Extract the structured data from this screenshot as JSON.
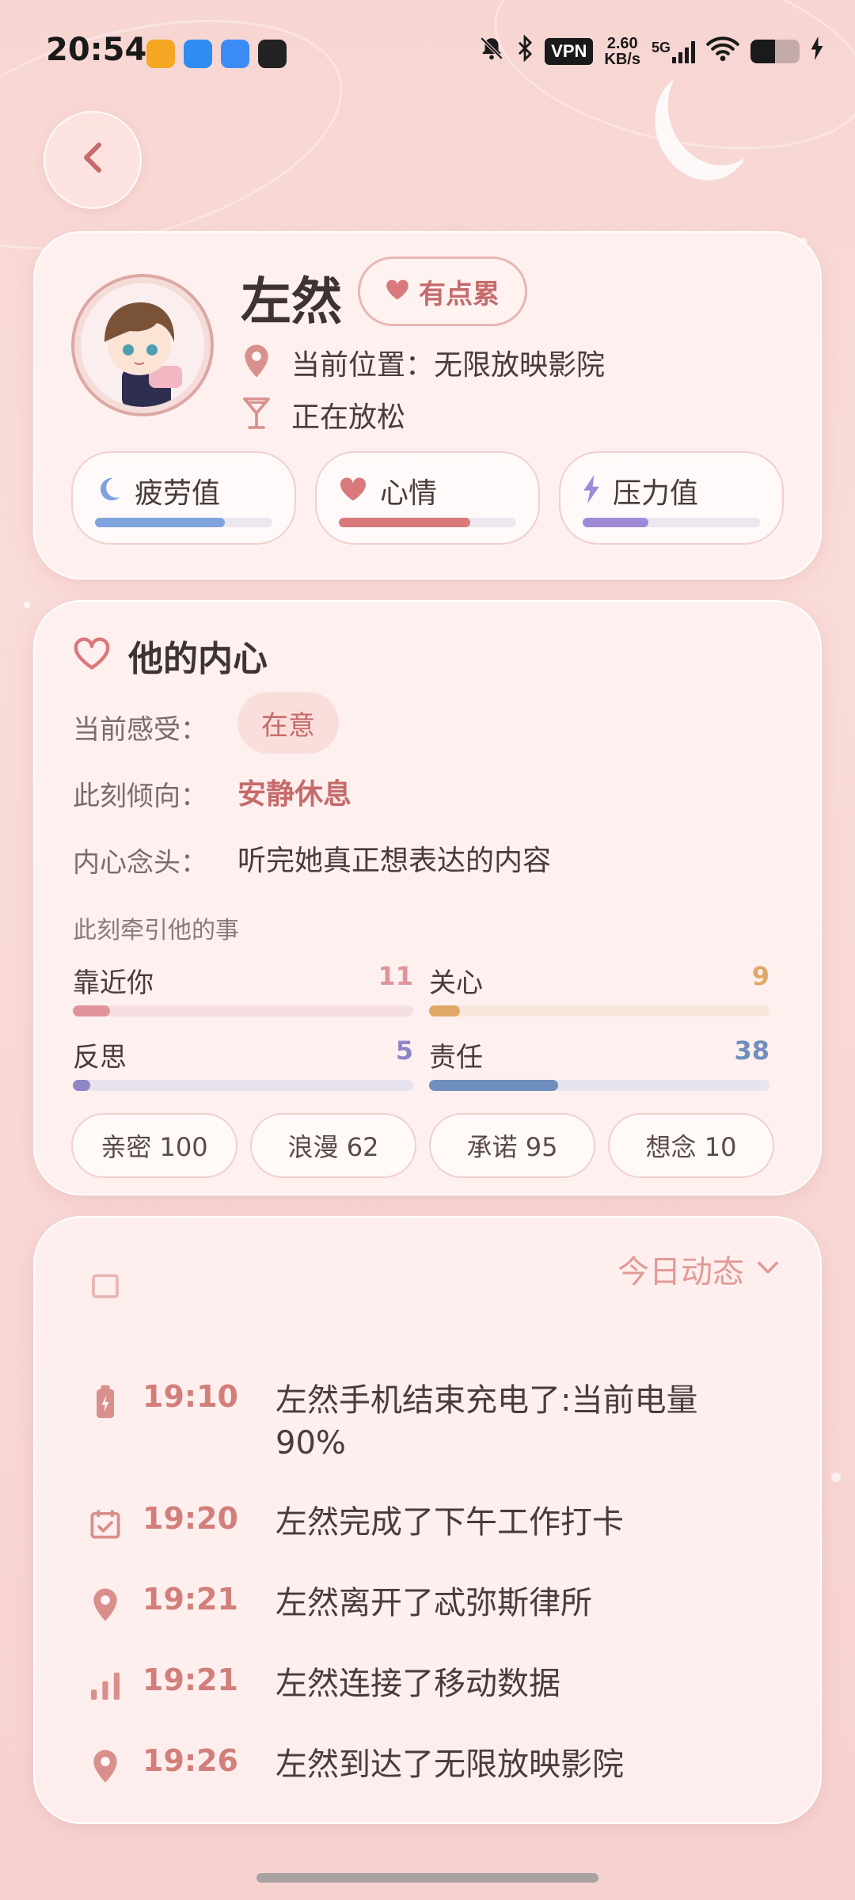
{
  "status_bar": {
    "time": "20:54",
    "vpn": "VPN",
    "net_speed_value": "2.60",
    "net_speed_unit": "KB/s",
    "network_type": "5G",
    "battery_level": 0.5
  },
  "profile": {
    "name": "左然",
    "mood_badge": "有点累",
    "location": "当前位置：无限放映影院",
    "activity": "正在放松",
    "stats": [
      {
        "label": "疲劳值",
        "level": 0.73,
        "color": "#7fa3dc",
        "icon": "moon-icon"
      },
      {
        "label": "心情",
        "level": 0.74,
        "color": "#d9797c",
        "icon": "heart-icon"
      },
      {
        "label": "压力值",
        "level": 0.37,
        "color": "#9f8ad8",
        "icon": "lightning-icon"
      }
    ]
  },
  "inner_heart": {
    "title": "他的内心",
    "feeling_label": "当前感受：",
    "feeling_value": "在意",
    "tendency_label": "此刻倾向：",
    "tendency_value": "安静休息",
    "thought_label": "内心念头：",
    "thought_value": "听完她真正想表达的内容",
    "attractions_title": "此刻牵引他的事",
    "attractions": [
      {
        "label": "靠近你",
        "value": "11",
        "level": 0.11,
        "color": "#e0949a",
        "track": "#f6dfe1"
      },
      {
        "label": "关心",
        "value": "9",
        "level": 0.09,
        "color": "#e0a867",
        "track": "#f7e7da"
      },
      {
        "label": "反思",
        "value": "5",
        "level": 0.05,
        "color": "#8e86c6",
        "track": "#e8e2ee"
      },
      {
        "label": "责任",
        "value": "38",
        "level": 0.38,
        "color": "#6f8fbf",
        "track": "#e6e4ec"
      }
    ],
    "tags": [
      "亲密 100",
      "浪漫 62",
      "承诺 95",
      "想念 10"
    ]
  },
  "feed": {
    "header": "今日动态",
    "items": [
      {
        "time": "19:10",
        "text": "左然手机结束充电了:当前电量90%",
        "icon": "battery-charging-icon"
      },
      {
        "time": "19:20",
        "text": "左然完成了下午工作打卡",
        "icon": "calendar-check-icon"
      },
      {
        "time": "19:21",
        "text": "左然离开了忒弥斯律所",
        "icon": "location-pin-icon"
      },
      {
        "time": "19:21",
        "text": "左然连接了移动数据",
        "icon": "signal-bars-icon"
      },
      {
        "time": "19:26",
        "text": "左然到达了无限放映影院",
        "icon": "location-pin-icon"
      }
    ]
  },
  "colors": {
    "accent": "#c56b6b",
    "accent_light": "#e39a96",
    "background": "#f8d8d6"
  }
}
